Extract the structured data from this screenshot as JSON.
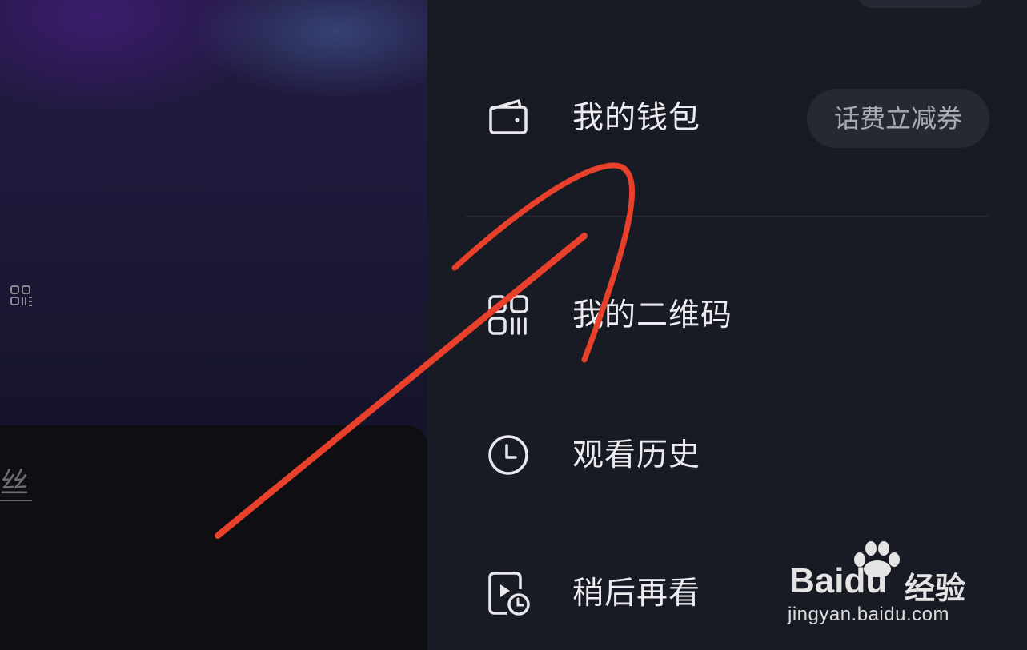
{
  "left_pane": {
    "fans_label": "丝"
  },
  "drawer": {
    "items": [
      {
        "label": "我的钱包",
        "icon": "wallet-icon"
      },
      {
        "label": "我的二维码",
        "icon": "qr-code-icon"
      },
      {
        "label": "观看历史",
        "icon": "clock-icon"
      },
      {
        "label": "稍后再看",
        "icon": "watch-later-icon"
      }
    ],
    "wallet_badge": "话费立减券"
  },
  "watermark": {
    "logo": "Baidu",
    "cn": "经验",
    "url": "jingyan.baidu.com"
  },
  "colors": {
    "drawer_bg": "#191b24",
    "annotation": "#e8402a"
  }
}
